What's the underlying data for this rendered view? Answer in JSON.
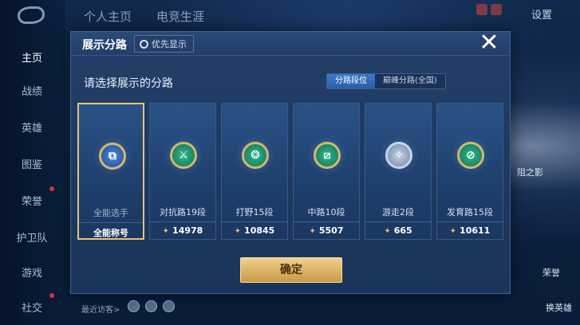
{
  "nav": {
    "items": [
      {
        "label": "主页",
        "active": true
      },
      {
        "label": "战绩"
      },
      {
        "label": "英雄"
      },
      {
        "label": "图鉴"
      },
      {
        "label": "荣誉"
      },
      {
        "label": "护卫队"
      },
      {
        "label": "游戏"
      },
      {
        "label": "社交"
      }
    ]
  },
  "top": {
    "tabs": [
      "个人主页",
      "电竞生涯"
    ],
    "settings": "设置"
  },
  "modal": {
    "title": "展示分路",
    "priority_label": "优先显示",
    "close_icon": "close-icon",
    "prompt": "请选择展示的分路",
    "segments": [
      {
        "label": "分路段位",
        "active": true
      },
      {
        "label": "巅峰分路(全国)",
        "active": false
      }
    ],
    "cards": [
      {
        "name": "全能选手",
        "score_label": "全能称号",
        "selected": true,
        "emblem": "all-round-emblem-icon"
      },
      {
        "name": "对抗路19段",
        "score": "14978",
        "emblem": "clash-lane-emblem-icon"
      },
      {
        "name": "打野15段",
        "score": "10845",
        "emblem": "jungle-emblem-icon"
      },
      {
        "name": "中路10段",
        "score": "5507",
        "emblem": "mid-lane-emblem-icon"
      },
      {
        "name": "游走2段",
        "score": "665",
        "emblem": "roam-emblem-icon"
      },
      {
        "name": "发育路15段",
        "score": "10611",
        "emblem": "farm-lane-emblem-icon"
      }
    ],
    "confirm_label": "确定"
  },
  "bottom": {
    "hint": "最近访客>"
  },
  "right": {
    "label_a": "阻之影",
    "label_b": "荣誉",
    "label_c": "换英雄"
  },
  "colors": {
    "gold": "#e7c27a",
    "accent_blue": "#2a5fa8",
    "panel": "#1b3459"
  }
}
